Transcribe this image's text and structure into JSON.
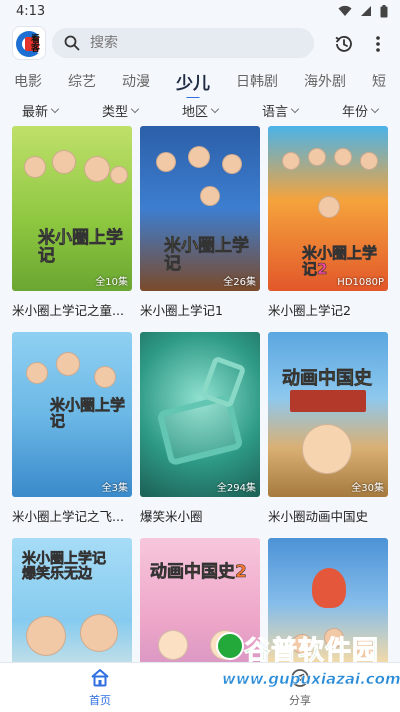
{
  "status": {
    "time": "4:13"
  },
  "app": {
    "logo_text": "看客"
  },
  "search": {
    "placeholder": "搜索"
  },
  "tabs": [
    {
      "label": "电影"
    },
    {
      "label": "综艺"
    },
    {
      "label": "动漫"
    },
    {
      "label": "少儿",
      "active": true
    },
    {
      "label": "日韩剧"
    },
    {
      "label": "海外剧"
    },
    {
      "label": "短"
    }
  ],
  "filters": [
    {
      "label": "最新"
    },
    {
      "label": "类型"
    },
    {
      "label": "地区"
    },
    {
      "label": "语言"
    },
    {
      "label": "年份"
    }
  ],
  "videos": [
    {
      "title": "米小圈上学记之童...",
      "badge": "全10集",
      "art_text": "米小圈上学记",
      "bg": "#a8d24a"
    },
    {
      "title": "米小圈上学记1",
      "badge": "全26集",
      "art_text": "米小圈上学记",
      "bg": "#3b6fb8"
    },
    {
      "title": "米小圈上学记2",
      "badge": "HD1080P",
      "art_text": "米小圈上学记2",
      "bg": "#f08a2c"
    },
    {
      "title": "米小圈上学记之飞...",
      "badge": "全3集",
      "art_text": "米小圈上学记",
      "bg": "#7fc2e8"
    },
    {
      "title": "爆笑米小圈",
      "badge": "全294集",
      "art_text": "",
      "bg": "#2f8a7a"
    },
    {
      "title": "米小圈动画中国史",
      "badge": "全30集",
      "art_text": "动画中国史",
      "bg": "#5aa0d8"
    },
    {
      "title": "",
      "badge": "",
      "art_text": "米小圈上学记 爆笑乐无边",
      "bg": "#8fd0f0"
    },
    {
      "title": "",
      "badge": "",
      "art_text": "动画中国史2",
      "bg": "#f5b8d4"
    },
    {
      "title": "",
      "badge": "",
      "art_text": "",
      "bg": "#6ab0e0"
    }
  ],
  "nav": [
    {
      "label": "首页",
      "icon": "home-icon",
      "active": true
    },
    {
      "label": "分享",
      "icon": "compass-icon",
      "active": false
    }
  ],
  "watermark": {
    "main": "谷普软件园",
    "sub": "www.gupuxiazai.com"
  },
  "colors": {
    "accent": "#2f6fe0",
    "background": "#f4f7fb"
  }
}
